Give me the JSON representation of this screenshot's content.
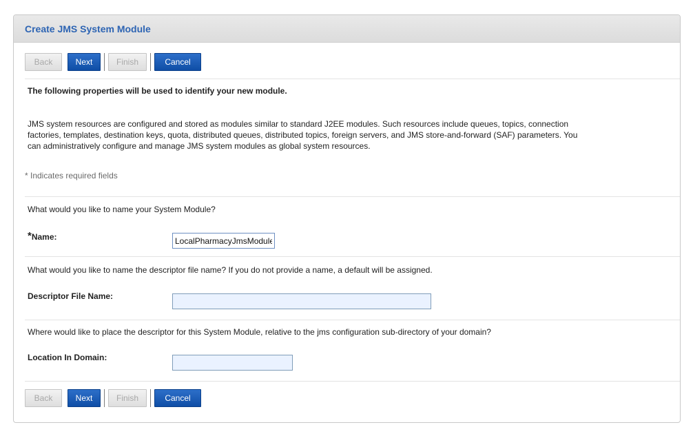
{
  "title": "Create JMS System Module",
  "buttons": {
    "back": "Back",
    "next": "Next",
    "finish": "Finish",
    "cancel": "Cancel"
  },
  "intro_heading": "The following properties will be used to identify your new module.",
  "description_lines": [
    "JMS system resources are configured and stored as modules similar to standard J2EE modules. Such resources include queues, topics, connection",
    "factories, templates, destination keys, quota, distributed queues, distributed topics, foreign servers, and JMS store-and-forward (SAF) parameters. You",
    "can administratively configure and manage JMS system modules as global system resources."
  ],
  "required_note": "* Indicates required fields",
  "name_section": {
    "question": "What would you like to name your System Module?",
    "required_marker": "*",
    "label": "Name:",
    "value": "LocalPharmacyJmsModule"
  },
  "descriptor_section": {
    "question": "What would you like to name the descriptor file name? If you do not provide a name, a default will be assigned.",
    "label": "Descriptor File Name:",
    "value": ""
  },
  "location_section": {
    "question": "Where would like to place the descriptor for this System Module, relative to the jms configuration sub-directory of your domain?",
    "label": "Location In Domain:",
    "value": ""
  }
}
